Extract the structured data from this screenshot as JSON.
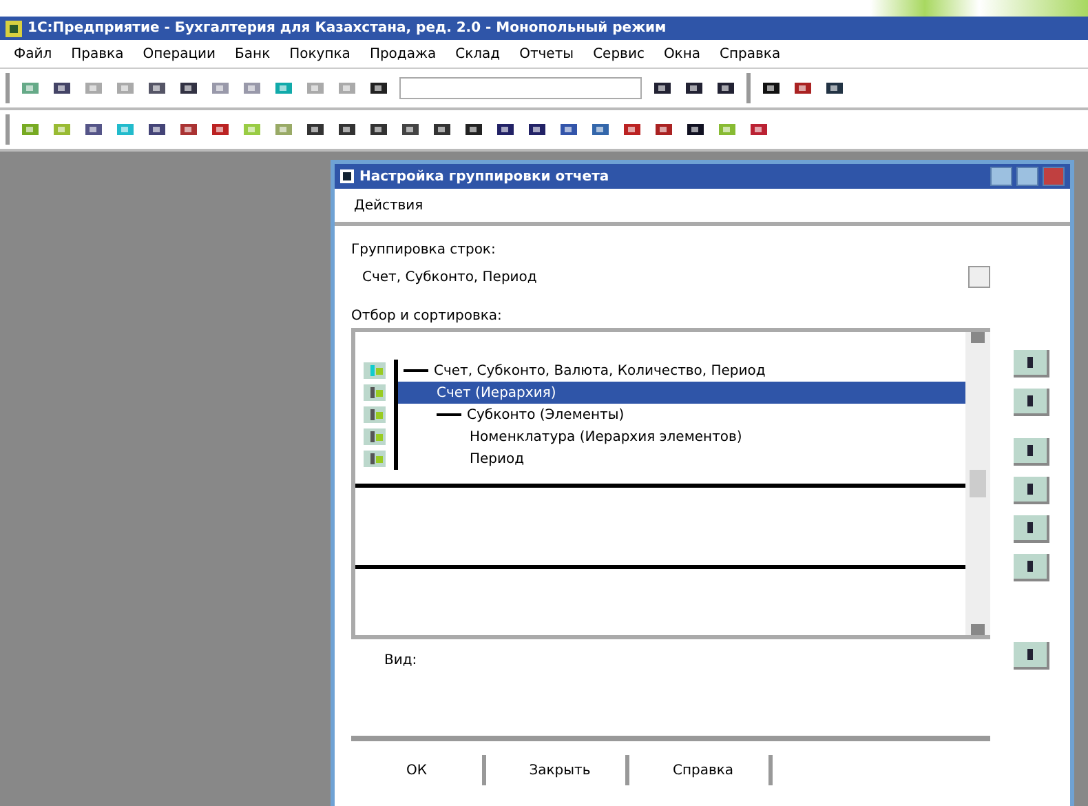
{
  "window": {
    "title": "1С:Предприятие - Бухгалтерия для Казахстана, ред. 2.0 - Монопольный режим"
  },
  "menu": [
    "Файл",
    "Правка",
    "Операции",
    "Банк",
    "Покупка",
    "Продажа",
    "Склад",
    "Отчеты",
    "Сервис",
    "Окна",
    "Справка"
  ],
  "dialog": {
    "title": "Настройка группировки отчета",
    "toolbar": [
      "Действия"
    ],
    "field_label": "Группировка строк:",
    "field_value": "Счет, Субконто, Период",
    "list_label": "Отбор и сортировка:",
    "rows": [
      {
        "text": "Счет, Субконто, Валюта, Количество, Период",
        "selected": false,
        "expanded": true,
        "children": [
          {
            "text": "Счет (Иерархия)",
            "selected": true
          },
          {
            "text": "Субконто (Элементы)",
            "selected": false,
            "expanded": true,
            "children": [
              {
                "text": "Номенклатура (Иерархия элементов)",
                "selected": false
              },
              {
                "text": "Период",
                "selected": false
              }
            ]
          }
        ]
      }
    ],
    "note": "Вид:",
    "buttons": [
      "ОК",
      "Закрыть",
      "Справка"
    ]
  }
}
